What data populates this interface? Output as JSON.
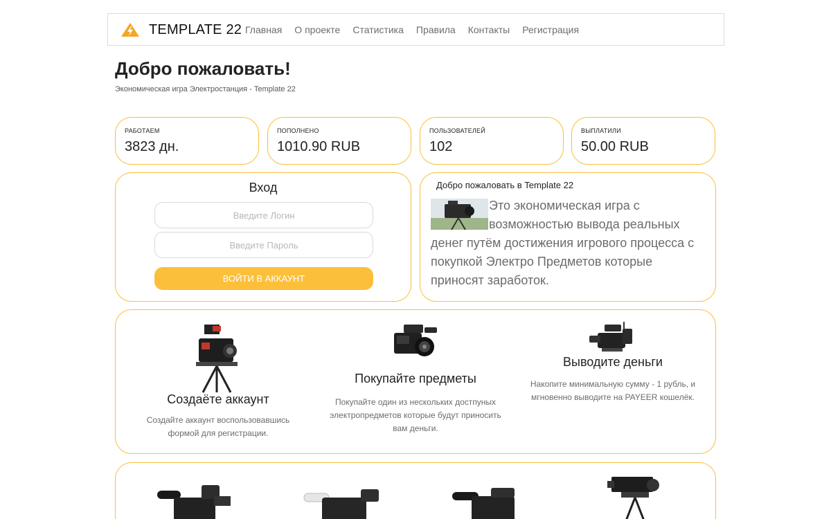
{
  "header": {
    "brand": "TEMPLATE 22",
    "nav": [
      "Главная",
      "О проекте",
      "Статистика",
      "Правила",
      "Контакты",
      "Регистрация"
    ]
  },
  "page": {
    "title": "Добро пожаловать!",
    "subtitle": "Экономическая игра Электростанция - Template 22"
  },
  "stats": [
    {
      "label": "Работаем",
      "value": "3823 дн."
    },
    {
      "label": "Пополнено",
      "value": "1010.90 RUB"
    },
    {
      "label": "Пользователей",
      "value": "102"
    },
    {
      "label": "Выплатили",
      "value": "50.00 RUB"
    }
  ],
  "login": {
    "title": "Вход",
    "login_placeholder": "Введите Логин",
    "password_placeholder": "Введите Пароль",
    "button": "Войти в аккаунт"
  },
  "welcome": {
    "heading": "Добро пожаловать в Template 22",
    "text": "Это экономическая игра с возможностью вывода реальных денег путём достижения игрового процесса с покупкой Электро Предметов которые приносят заработок."
  },
  "steps": [
    {
      "title": "Создаёте аккаунт",
      "desc": "Создайте аккаунт воспользовавшись формой для регистрации."
    },
    {
      "title": "Покупайте предметы",
      "desc": "Покупайте один из нескольких достпуных электропредметов которые будут приносить вам деньги."
    },
    {
      "title": "Выводите деньги",
      "desc": "Накопите минимальную сумму - 1 рубль, и мгновенно выводите на PAYEER кошелёк."
    }
  ],
  "colors": {
    "accent": "#fbbf3a",
    "text": "#222222",
    "muted": "#6b6b6b"
  }
}
